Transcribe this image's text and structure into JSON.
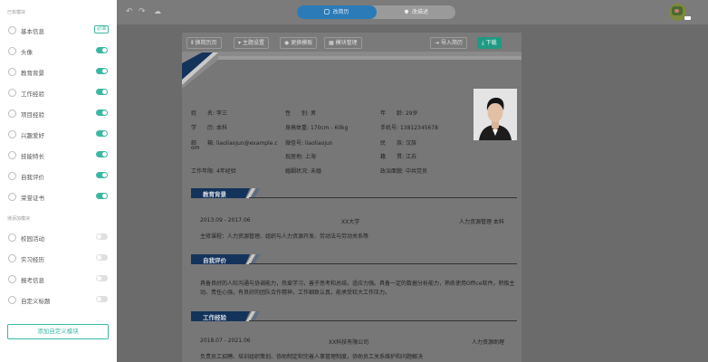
{
  "sidebar": {
    "added_title": "已有模块",
    "required_tag": "必填",
    "added_items": [
      {
        "label": "基本信息",
        "icon": "user-info-icon"
      },
      {
        "label": "头像",
        "icon": "avatar-icon"
      },
      {
        "label": "教育背景",
        "icon": "education-icon"
      },
      {
        "label": "工作经验",
        "icon": "work-icon"
      },
      {
        "label": "项目经验",
        "icon": "project-icon"
      },
      {
        "label": "兴趣爱好",
        "icon": "hobby-icon"
      },
      {
        "label": "技能特长",
        "icon": "skill-icon"
      },
      {
        "label": "自我评价",
        "icon": "self-eval-icon"
      },
      {
        "label": "荣誉证书",
        "icon": "certificate-icon"
      }
    ],
    "pending_title": "待添加模块",
    "pending_items": [
      {
        "label": "校园活动",
        "icon": "campus-icon"
      },
      {
        "label": "实习经历",
        "icon": "internship-icon"
      },
      {
        "label": "报考信息",
        "icon": "exam-icon"
      },
      {
        "label": "自定义标题",
        "icon": "custom-title-icon"
      }
    ],
    "add_button": "添加自定义模块"
  },
  "topbar": {
    "undo_icon": "undo-icon",
    "redo_icon": "redo-icon",
    "cloud_icon": "cloud-icon",
    "tab_edit": "改简历",
    "tab_preview": "改描述"
  },
  "toolbar": {
    "buttons": [
      "换简历页",
      "主题设置",
      "更换模板",
      "模块管理"
    ],
    "import": "导入简历",
    "download": "下载"
  },
  "resume": {
    "basic": [
      {
        "k": "姓　　名:",
        "v": "李三"
      },
      {
        "k": "性　　别:",
        "v": "男"
      },
      {
        "k": "年　　龄:",
        "v": "29岁"
      },
      {
        "k": "学　　历:",
        "v": "本科"
      },
      {
        "k": "身高体重:",
        "v": "170cm - 60kg"
      },
      {
        "k": "手机号:",
        "v": "13812345678"
      },
      {
        "k": "邮　　箱:",
        "v": "liaoliaojun@example.c"
      },
      {
        "k": "",
        "v": "om"
      },
      {
        "k": "微信号:",
        "v": "liaoliaojun"
      },
      {
        "k": "民　　族:",
        "v": "汉族"
      },
      {
        "k": "现居地:",
        "v": "上海"
      },
      {
        "k": "籍　　贯:",
        "v": "江苏"
      },
      {
        "k": "工作年限:",
        "v": "4年经验"
      },
      {
        "k": "婚姻状况:",
        "v": "未婚"
      },
      {
        "k": "政治面貌:",
        "v": "中共党员"
      }
    ],
    "education_title": "教育背景",
    "education": {
      "period": "2013.09 - 2017.06",
      "school": "XX大学",
      "major": "人力资源管理 本科",
      "courses": "主修课程：人力资源管理、组织与人力资源开发、劳动法与劳动关系等"
    },
    "self_eval_title": "自我评价",
    "self_eval": "具备良好的人际沟通与协调能力，热爱学习，善于思考和总结，适应力强。具备一定的数据分析能力，熟练使用Office软件。积极主动、责任心强，有良好的团队合作精神，工作细致认真，能承受较大工作压力。",
    "work_title": "工作经验",
    "work": {
      "period": "2018.07 - 2021.06",
      "company": "XX科技有限公司",
      "role": "人力资源助理",
      "desc": "负责员工招聘、培训组织策划、协助制定和完善人事管理制度，协助员工关系维护和问题解决"
    }
  },
  "colors": {
    "accent": "#3bb8a4",
    "download": "#219a83",
    "tab_active": "#2a7bb8",
    "section_bar": "#14335b"
  }
}
